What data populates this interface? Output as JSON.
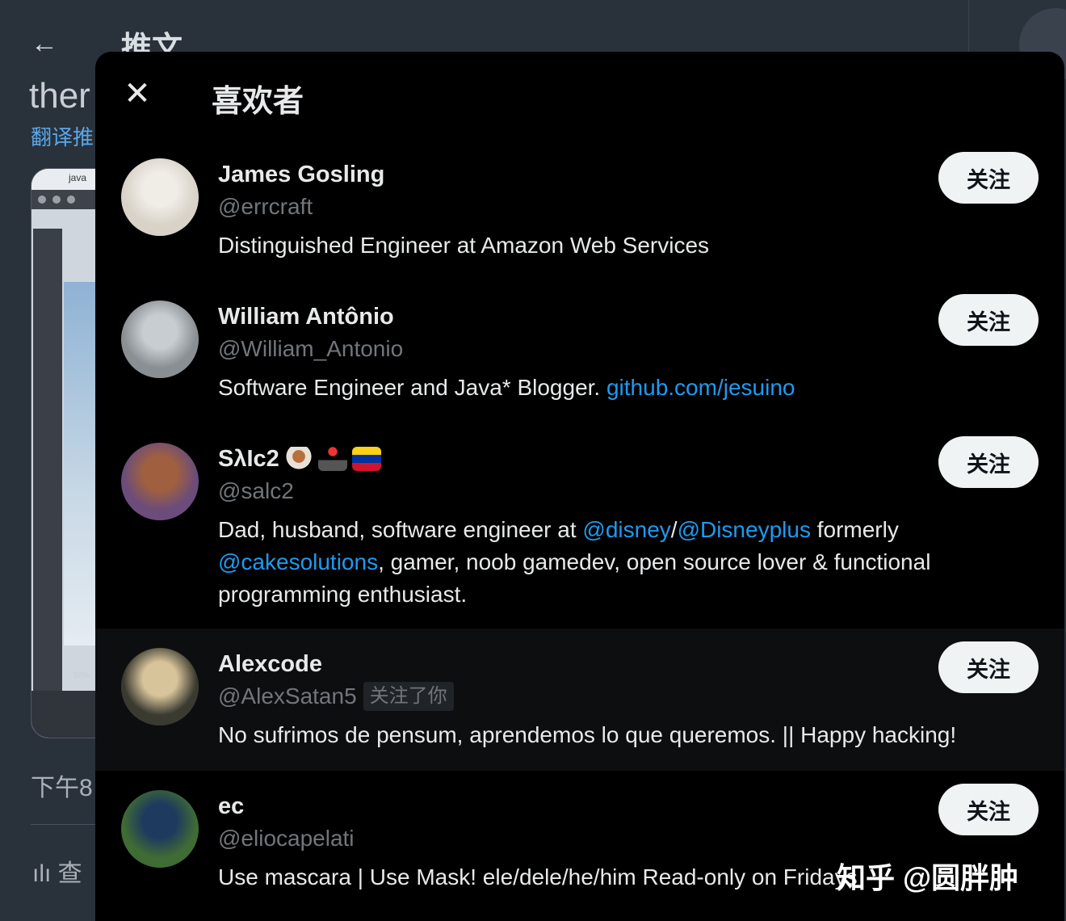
{
  "background": {
    "back_icon": "←",
    "title": "推文",
    "tweet_text": "ther",
    "translate": "翻译推",
    "screenshot_bar": "java",
    "screenshot_zoom": "50%",
    "time": "下午8",
    "stats": "ılı 查"
  },
  "modal": {
    "close_icon": "✕",
    "title": "喜欢者"
  },
  "users": [
    {
      "name": "James Gosling",
      "handle": "@errcraft",
      "follows_you": "",
      "bio_parts": [
        {
          "text": "Distinguished Engineer at Amazon Web Services",
          "link": false
        }
      ],
      "follow_label": "关注",
      "avatar_colors": [
        "#d8d2c8",
        "#f0ece6"
      ]
    },
    {
      "name": "William Antônio",
      "handle": "@William_Antonio",
      "follows_you": "",
      "bio_parts": [
        {
          "text": "Software Engineer and Java* Blogger. ",
          "link": false
        },
        {
          "text": "github.com/jesuino",
          "link": true
        }
      ],
      "follow_label": "关注",
      "avatar_colors": [
        "#8a8f94",
        "#c8cdd2"
      ]
    },
    {
      "name": "SλIc2",
      "handle": "@salc2",
      "follows_you": "",
      "emojis": [
        "coffee-emoji",
        "joystick-emoji",
        "venezuela-flag-emoji"
      ],
      "bio_parts": [
        {
          "text": "Dad, husband, software engineer at ",
          "link": false
        },
        {
          "text": "@disney",
          "link": true
        },
        {
          "text": "/",
          "link": false
        },
        {
          "text": "@Disneyplus",
          "link": true
        },
        {
          "text": " formerly ",
          "link": false
        },
        {
          "text": "@cakesolutions",
          "link": true
        },
        {
          "text": ", gamer, noob gamedev, open source lover & functional programming enthusiast.",
          "link": false
        }
      ],
      "follow_label": "关注",
      "avatar_colors": [
        "#6b4c7a",
        "#a06040"
      ]
    },
    {
      "name": "Alexcode",
      "handle": "@AlexSatan5",
      "follows_you": "关注了你",
      "bio_parts": [
        {
          "text": "No sufrimos de pensum, aprendemos lo que queremos. || Happy hacking!",
          "link": false
        }
      ],
      "follow_label": "关注",
      "avatar_colors": [
        "#3a3a30",
        "#d8c49a"
      ]
    },
    {
      "name": "ec",
      "handle": "@eliocapelati",
      "follows_you": "",
      "bio_parts": [
        {
          "text": "Use mascara | Use Mask! ele/dele/he/him Read-only on Fridays",
          "link": false
        }
      ],
      "follow_label": "关注",
      "avatar_colors": [
        "#3f6b34",
        "#1e3a5f"
      ]
    }
  ],
  "watermark": "知乎 @圆胖肿"
}
